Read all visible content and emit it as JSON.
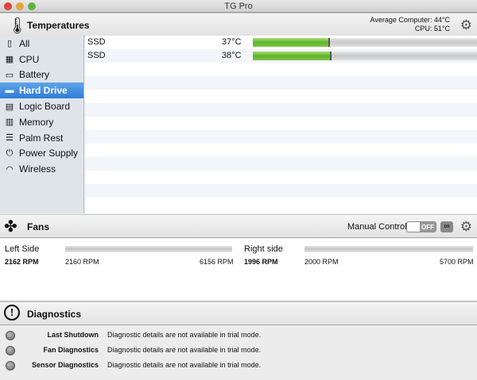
{
  "window": {
    "title": "TG Pro"
  },
  "temperatures": {
    "title": "Temperatures",
    "avg_label": "Average Computer:",
    "avg_value": "44°C",
    "cpu_label": "CPU:",
    "cpu_value": "51°C"
  },
  "sidebar": {
    "items": [
      {
        "label": "All"
      },
      {
        "label": "CPU"
      },
      {
        "label": "Battery"
      },
      {
        "label": "Hard Drive",
        "selected": true
      },
      {
        "label": "Logic Board"
      },
      {
        "label": "Memory"
      },
      {
        "label": "Palm Rest"
      },
      {
        "label": "Power Supply"
      },
      {
        "label": "Wireless"
      }
    ]
  },
  "sensors": [
    {
      "name": "SSD",
      "value": "37°C",
      "fill": 0.345
    },
    {
      "name": "SSD",
      "value": "38°C",
      "fill": 0.35
    }
  ],
  "fans": {
    "title": "Fans",
    "manual_label": "Manual Control",
    "toggle": "OFF",
    "items": [
      {
        "name": "Left Side",
        "current": "2162 RPM",
        "min": "2160 RPM",
        "max": "6156 RPM"
      },
      {
        "name": "Right side",
        "current": "1996 RPM",
        "min": "2000 RPM",
        "max": "5700 RPM"
      }
    ]
  },
  "diagnostics": {
    "title": "Diagnostics",
    "items": [
      {
        "label": "Last Shutdown",
        "text": "Diagnostic details are not available in trial mode."
      },
      {
        "label": "Fan Diagnostics",
        "text": "Diagnostic details are not available in trial mode."
      },
      {
        "label": "Sensor Diagnostics",
        "text": "Diagnostic details are not available in trial mode."
      }
    ]
  }
}
